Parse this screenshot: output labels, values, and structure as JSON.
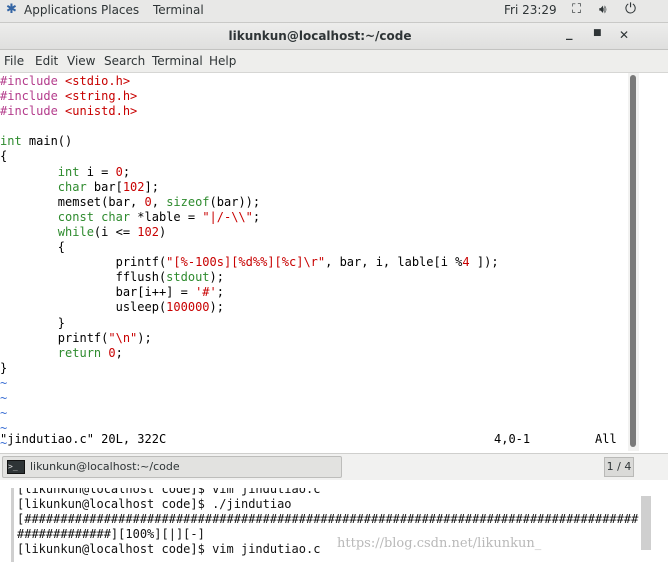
{
  "topbar": {
    "applications": "Applications",
    "places": "Places",
    "terminal": "Terminal",
    "clock": "Fri 23:29"
  },
  "window": {
    "title": "likunkun@localhost:~/code"
  },
  "menubar": {
    "items": [
      "File",
      "Edit",
      "View",
      "Search",
      "Terminal",
      "Help"
    ]
  },
  "editor": {
    "code_lines": [
      [
        [
          "pp",
          "#include "
        ],
        [
          "str",
          "<stdio.h>"
        ]
      ],
      [
        [
          "pp",
          "#include "
        ],
        [
          "str",
          "<string.h>"
        ]
      ],
      [
        [
          "pp",
          "#include "
        ],
        [
          "str",
          "<unistd.h>"
        ]
      ],
      [],
      [
        [
          "kw",
          "int"
        ],
        [
          "",
          " main()"
        ]
      ],
      [
        [
          "",
          "{"
        ]
      ],
      [
        [
          "",
          "        "
        ],
        [
          "kw",
          "int"
        ],
        [
          "",
          " i = "
        ],
        [
          "num",
          "0"
        ],
        [
          "",
          ";"
        ]
      ],
      [
        [
          "",
          "        "
        ],
        [
          "kw",
          "char"
        ],
        [
          "",
          " bar["
        ],
        [
          "num",
          "102"
        ],
        [
          "",
          "];"
        ]
      ],
      [
        [
          "",
          "        memset(bar, "
        ],
        [
          "num",
          "0"
        ],
        [
          "",
          ", "
        ],
        [
          "kw",
          "sizeof"
        ],
        [
          "",
          "(bar));"
        ]
      ],
      [
        [
          "",
          "        "
        ],
        [
          "kw",
          "const"
        ],
        [
          "",
          " "
        ],
        [
          "kw",
          "char"
        ],
        [
          "",
          " *lable = "
        ],
        [
          "str",
          "\"|/-\\\\\""
        ],
        [
          "",
          ";"
        ]
      ],
      [
        [
          "",
          "        "
        ],
        [
          "kw",
          "while"
        ],
        [
          "",
          "(i <= "
        ],
        [
          "num",
          "102"
        ],
        [
          "",
          ")"
        ]
      ],
      [
        [
          "",
          "        {"
        ]
      ],
      [
        [
          "",
          "                printf("
        ],
        [
          "str",
          "\"[%-100s][%d%%][%c]\\r\""
        ],
        [
          "",
          ", bar, i, lable[i %"
        ],
        [
          "num",
          "4"
        ],
        [
          "",
          " ]);"
        ]
      ],
      [
        [
          "",
          "                fflush("
        ],
        [
          "kw",
          "stdout"
        ],
        [
          "",
          ");"
        ]
      ],
      [
        [
          "",
          "                bar[i++] = "
        ],
        [
          "str",
          "'#'"
        ],
        [
          "",
          ";"
        ]
      ],
      [
        [
          "",
          "                usleep("
        ],
        [
          "num",
          "100000"
        ],
        [
          "",
          ");"
        ]
      ],
      [
        [
          "",
          "        }"
        ]
      ],
      [
        [
          "",
          "        printf("
        ],
        [
          "str",
          "\"\\n\""
        ],
        [
          "",
          ");"
        ]
      ],
      [
        [
          "",
          "        "
        ],
        [
          "kw",
          "return"
        ],
        [
          "",
          " "
        ],
        [
          "num",
          "0"
        ],
        [
          "",
          ";"
        ]
      ],
      [
        [
          "",
          "}"
        ]
      ],
      [
        [
          "tl",
          "~"
        ]
      ],
      [
        [
          "tl",
          "~"
        ]
      ],
      [
        [
          "tl",
          "~"
        ]
      ],
      [
        [
          "tl",
          "~"
        ]
      ],
      [
        [
          "tl",
          "~"
        ]
      ]
    ],
    "status_file": "\"jindutiao.c\" 20L, 322C",
    "status_pos": "4,0-1",
    "status_all": "All"
  },
  "taskbar": {
    "item_label": "likunkun@localhost:~/code",
    "workspace": "1 / 4"
  },
  "lower_terminal": {
    "lines": [
      "[likunkun@localhost code]$ vim jindutiao.c",
      "[likunkun@localhost code]$ ./jindutiao",
      "[#####################################################################################",
      "#############][100%][|][-]",
      "[likunkun@localhost code]$ vim jindutiao.c"
    ]
  },
  "watermark": "https://blog.csdn.net/likunkun_",
  "colors": {
    "preprocessor": "#b43c8c",
    "string": "#c80000",
    "keyword": "#2e8b2e",
    "tilde": "#3b6fd4"
  }
}
